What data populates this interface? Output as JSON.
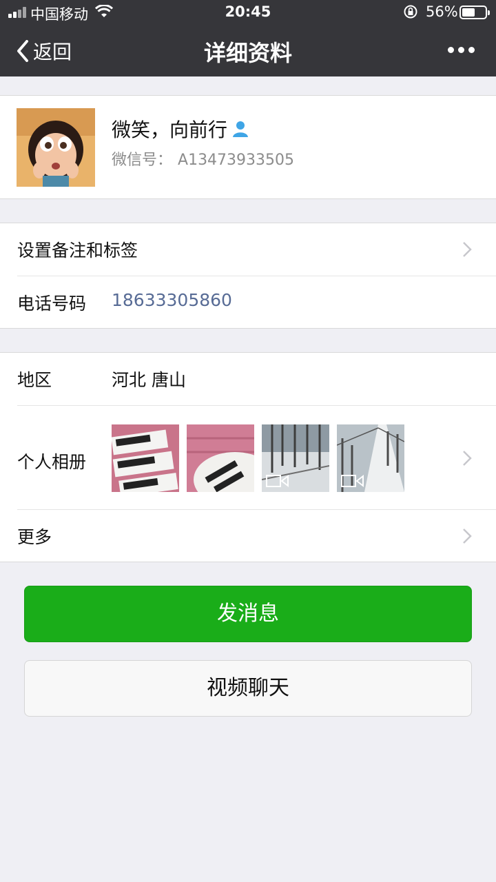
{
  "status_bar": {
    "carrier": "中国移动",
    "time": "20:45",
    "battery_percent": "56%",
    "battery_level": 0.56
  },
  "nav": {
    "back_label": "返回",
    "title": "详细资料"
  },
  "profile": {
    "nickname": "微笑，向前行",
    "wechat_id_label": "微信号：",
    "wechat_id": "A13473933505"
  },
  "section1": {
    "remark_label": "设置备注和标签",
    "phone_label": "电话号码",
    "phone_value": "18633305860"
  },
  "section2": {
    "region_label": "地区",
    "region_value": "河北 唐山",
    "album_label": "个人相册",
    "more_label": "更多"
  },
  "actions": {
    "send_message": "发消息",
    "video_chat": "视频聊天"
  },
  "colors": {
    "nav_bg": "#36363a",
    "primary_green": "#1aad19",
    "phone_link": "#576b95",
    "page_bg": "#efeff4"
  }
}
